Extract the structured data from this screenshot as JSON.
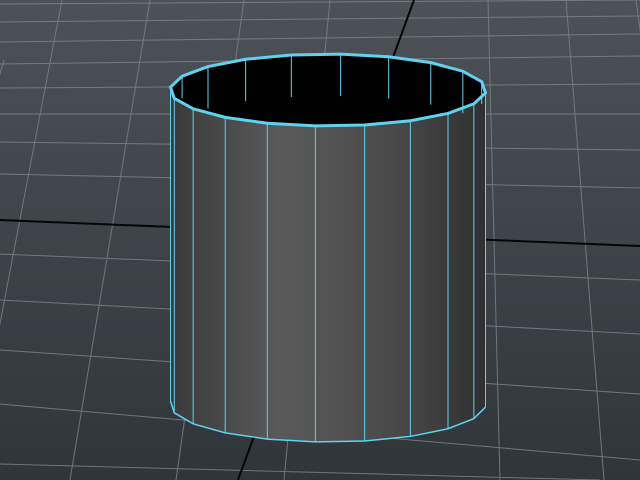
{
  "viewport": {
    "kind": "3d-perspective-viewport",
    "background_top": "#4c5258",
    "background_bottom": "#32373c",
    "grid_color": "#7b8186",
    "axis_line_color": "#050505"
  },
  "selected_object": {
    "kind": "open-cylinder",
    "subdivisions_axis": 20,
    "wireframe_color": "#5fd2f0",
    "body_color": "#4a4a4a",
    "interior_color": "#000000"
  }
}
